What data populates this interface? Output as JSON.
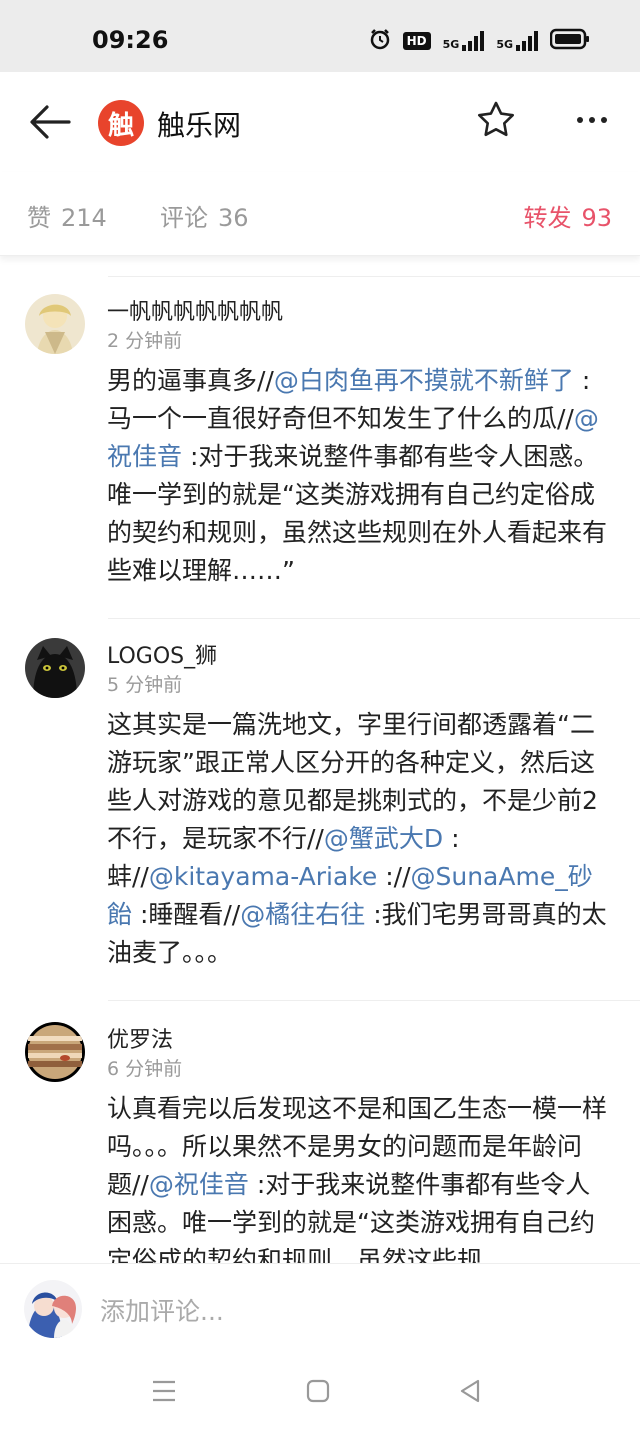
{
  "status_bar": {
    "time": "09:26",
    "hd_badge": "HD",
    "signal1_label": "5G",
    "signal2_label": "5G",
    "icons": [
      "alarm-icon",
      "hd-icon",
      "signal-5g-icon",
      "signal-5g-icon",
      "battery-icon"
    ]
  },
  "appbar": {
    "logo_char": "触",
    "title": "触乐网",
    "logo_color": "#e8442c"
  },
  "stats": {
    "like_label": "赞",
    "like_count": "214",
    "comment_label": "评论",
    "comment_count": "36",
    "repost_label": "转发",
    "repost_count": "93",
    "accent_color": "#e8536a"
  },
  "comments": [
    {
      "name": "一帆帆帆帆帆帆帆",
      "time": "2 分钟前",
      "parts": [
        {
          "t": "男的逼事真多//"
        },
        {
          "t": "@白肉鱼再不摸就不新鲜了",
          "mention": true
        },
        {
          "t": " :马一个一直很好奇但不知发生了什么的瓜//"
        },
        {
          "t": "@祝佳音",
          "mention": true
        },
        {
          "t": " :对于我来说整件事都有些令人困惑。唯一学到的就是“这类游戏拥有自己约定俗成的契约和规则，虽然这些规则在外人看起来有些难以理解……”"
        }
      ]
    },
    {
      "name": "LOGOS_狮",
      "time": "5 分钟前",
      "parts": [
        {
          "t": "这其实是一篇洗地文，字里行间都透露着“二游玩家”跟正常人区分开的各种定义，然后这些人对游戏的意见都是挑刺式的，不是少前2不行，是玩家不行//"
        },
        {
          "t": "@蟹武大D",
          "mention": true
        },
        {
          "t": " :蚌//"
        },
        {
          "t": "@kitayama-Ariake",
          "mention": true
        },
        {
          "t": " ://"
        },
        {
          "t": "@SunaAme_砂飴",
          "mention": true
        },
        {
          "t": " :睡醒看//"
        },
        {
          "t": "@橘往右往",
          "mention": true
        },
        {
          "t": " :我们宅男哥哥真的太油麦了。。。"
        }
      ]
    },
    {
      "name": "优罗法",
      "time": "6 分钟前",
      "parts": [
        {
          "t": "认真看完以后发现这不是和国乙生态一模一样吗。。。所以果然不是男女的问题而是年龄问题//"
        },
        {
          "t": "@祝佳音",
          "mention": true
        },
        {
          "t": " :对于我来说整件事都有些令人困惑。唯一学到的就是“这类游戏拥有自己约定俗成的契约和规则，虽然这些规"
        }
      ]
    }
  ],
  "mention_color": "#4a78b0",
  "input": {
    "placeholder": "添加评论..."
  },
  "navbar": {
    "buttons": [
      "menu-icon",
      "home-square-icon",
      "back-triangle-icon"
    ]
  }
}
